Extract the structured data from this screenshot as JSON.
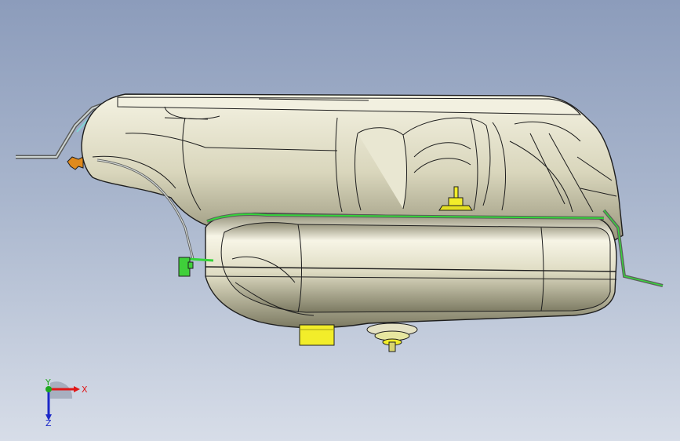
{
  "viewport": {
    "background_top": "#8c9cbb",
    "background_bottom": "#d7dde8"
  },
  "model": {
    "body_color": "#e6e3cc",
    "edge_color": "#1e1e1e",
    "strap_color": "#35d43a",
    "connector_color": "#f0e81a",
    "clip_color": "#e08a1c"
  },
  "triad": {
    "x_label": "X",
    "y_label": "Y",
    "z_label": "Z",
    "x_color": "#e01818",
    "y_color": "#1ea81e",
    "z_color": "#1c28c8"
  }
}
